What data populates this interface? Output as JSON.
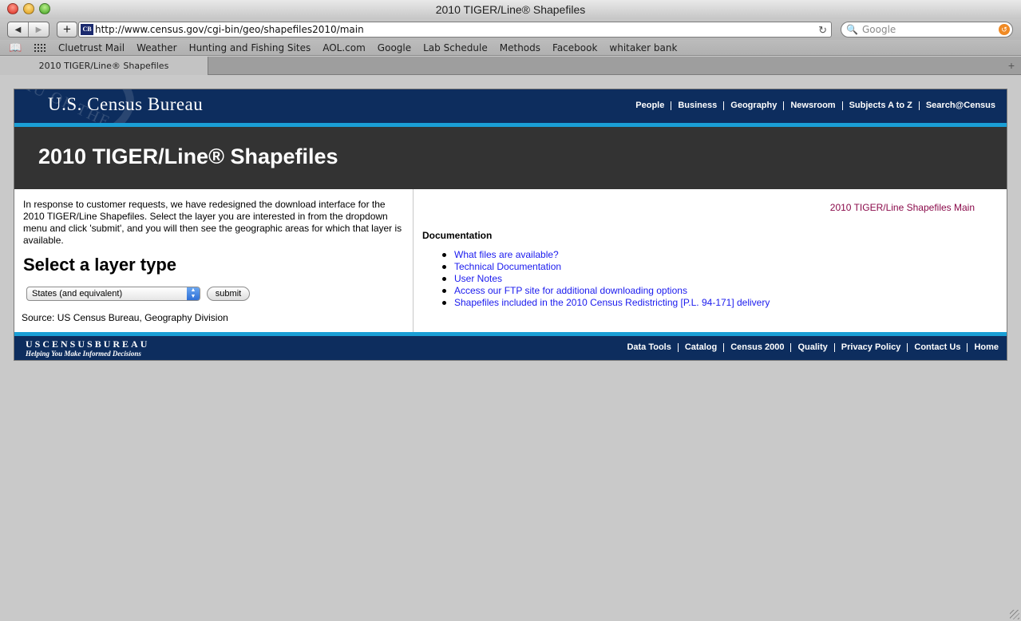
{
  "window": {
    "title": "2010 TIGER/Line® Shapefiles"
  },
  "toolbar": {
    "back": "◀",
    "forward": "▶",
    "add": "+",
    "favicon": "CB",
    "url": "http://www.census.gov/cgi-bin/geo/shapefiles2010/main",
    "reload": "↻",
    "search_icon": "🔍",
    "search_placeholder": "Google"
  },
  "bookmarks": {
    "items": [
      "Cluetrust Mail",
      "Weather",
      "Hunting and Fishing Sites",
      "AOL.com",
      "Google",
      "Lab Schedule",
      "Methods",
      "Facebook",
      "whitaker bank"
    ]
  },
  "tabs": [
    {
      "label": "2010 TIGER/Line® Shapefiles"
    }
  ],
  "site": {
    "logo": "U.S. Census Bureau",
    "seal_text": "AU OF THE",
    "topnav": [
      "People",
      "Business",
      "Geography",
      "Newsroom",
      "Subjects A to Z",
      "Search@Census"
    ],
    "banner_title": "2010 TIGER/Line® Shapefiles"
  },
  "left": {
    "intro": "In response to customer requests, we have redesigned the download interface for the 2010 TIGER/Line Shapefiles. Select the layer you are interested in from the dropdown menu and click 'submit', and you will then see the geographic areas for which that layer is available.",
    "heading": "Select a layer type",
    "select_value": "States (and equivalent)",
    "submit_label": "submit",
    "source": "Source: US Census Bureau, Geography Division"
  },
  "right": {
    "main_link": "2010 TIGER/Line Shapefiles Main",
    "doc_heading": "Documentation",
    "links": [
      "What files are available?",
      "Technical Documentation",
      "User Notes",
      "Access our FTP site for additional downloading options",
      "Shapefiles included in the 2010 Census Redistricting [P.L. 94-171] delivery"
    ]
  },
  "footer": {
    "logo": "USCENSUSBUREAU",
    "tagline": "Helping You Make Informed Decisions",
    "links": [
      "Data Tools",
      "Catalog",
      "Census 2000",
      "Quality",
      "Privacy Policy",
      "Contact Us",
      "Home"
    ]
  },
  "colors": {
    "header_navy": "#0d2d5e",
    "accent_cyan": "#1a9fd6",
    "banner_gray": "#333333",
    "link_blue": "#1a1aee",
    "main_link_maroon": "#8a0a4a"
  }
}
